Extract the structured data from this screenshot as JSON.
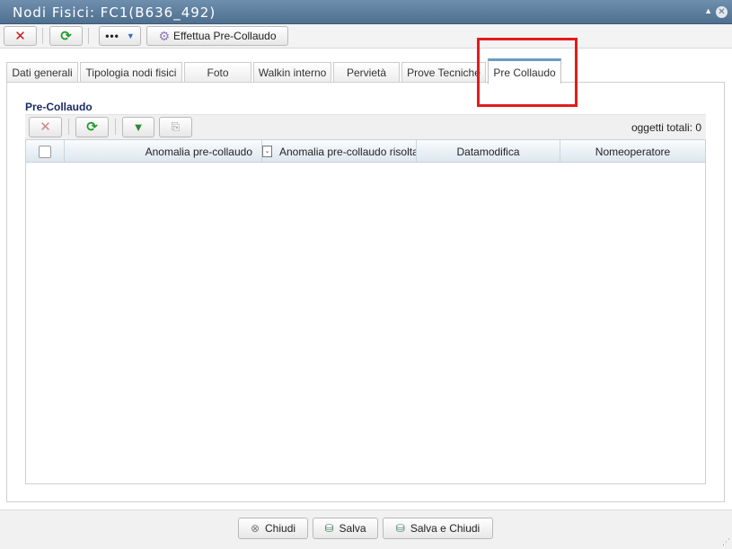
{
  "window": {
    "title": "Nodi Fisici: FC1(B636_492)"
  },
  "toolbar": {
    "more_label": "•••",
    "precollaudo_label": "Effettua Pre-Collaudo"
  },
  "tabs": [
    {
      "label": "Dati generali"
    },
    {
      "label": "Tipologia nodi fisici"
    },
    {
      "label": "Foto"
    },
    {
      "label": "Walkin interno"
    },
    {
      "label": "Pervietà"
    },
    {
      "label": "Prove Tecniche"
    },
    {
      "label": "Pre Collaudo"
    }
  ],
  "active_tab": "Pre Collaudo",
  "section": {
    "title": "Pre-Collaudo",
    "count_label": "oggetti totali: 0"
  },
  "grid": {
    "columns": [
      {
        "label": "Anomalia pre-collaudo"
      },
      {
        "label": "Anomalia pre-collaudo risolta"
      },
      {
        "label": "Datamodifica"
      },
      {
        "label": "Nomeoperatore"
      }
    ],
    "rows": []
  },
  "footer": {
    "close_label": "Chiudi",
    "save_label": "Salva",
    "save_close_label": "Salva e Chiudi"
  },
  "colors": {
    "titlebar": "#5f7f9f",
    "highlight": "#e31b1b",
    "active_tab_accent": "#6b9bc6"
  },
  "icons": [
    "close-x-icon",
    "refresh-icon",
    "more-icon",
    "chevron-down-icon",
    "gear-icon",
    "filter-icon",
    "export-icon",
    "save-icon"
  ]
}
